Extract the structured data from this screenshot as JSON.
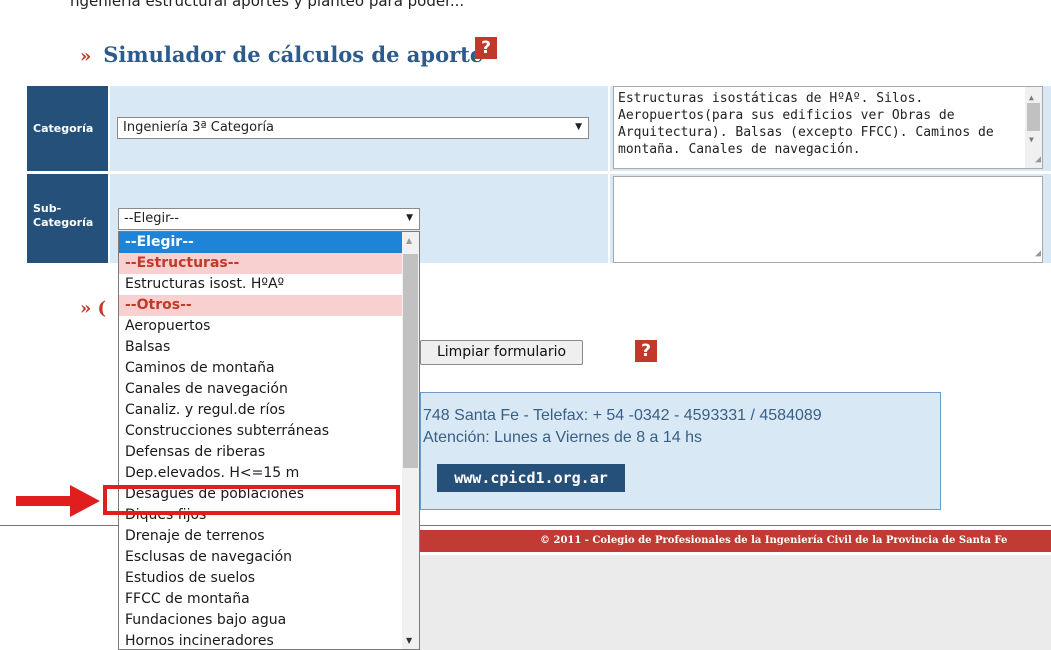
{
  "top_fragment": "ngeniería estructural aportes y planteo para poder...",
  "section_title": {
    "chevron": "»",
    "text": "Simulador de cálculos de aporte",
    "help": "?"
  },
  "row_categoria": {
    "label": "Categoría",
    "selected": "Ingeniería 3ª Categoría",
    "description": "Estructuras isostáticas de HºAº. Silos. Aeropuertos(para sus edificios ver Obras de Arquitectura). Balsas (excepto FFCC). Caminos de montaña. Canales de navegación."
  },
  "row_subcategoria": {
    "label_line1": "Sub-",
    "label_line2": "Categoría",
    "selected": "--Elegir--",
    "description": ""
  },
  "dropdown_items": [
    {
      "label": "--Elegir--",
      "kind": "selected"
    },
    {
      "label": "--Estructuras--",
      "kind": "group"
    },
    {
      "label": "Estructuras isost. HºAº",
      "kind": "option"
    },
    {
      "label": "--Otros--",
      "kind": "group"
    },
    {
      "label": "Aeropuertos",
      "kind": "option"
    },
    {
      "label": "Balsas",
      "kind": "option"
    },
    {
      "label": "Caminos de montaña",
      "kind": "option"
    },
    {
      "label": "Canales de navegación",
      "kind": "option"
    },
    {
      "label": "Canaliz. y regul.de ríos",
      "kind": "option"
    },
    {
      "label": "Construcciones subterráneas",
      "kind": "option"
    },
    {
      "label": "Defensas de riberas",
      "kind": "option"
    },
    {
      "label": "Dep.elevados. H<=15 m",
      "kind": "option"
    },
    {
      "label": "Desagües de poblaciones",
      "kind": "highlight"
    },
    {
      "label": "Diques fijos",
      "kind": "option"
    },
    {
      "label": "Drenaje de terrenos",
      "kind": "option"
    },
    {
      "label": "Esclusas de navegación",
      "kind": "option"
    },
    {
      "label": "Estudios de suelos",
      "kind": "option"
    },
    {
      "label": "FFCC de montaña",
      "kind": "option"
    },
    {
      "label": "Fundaciones bajo agua",
      "kind": "option"
    },
    {
      "label": "Hornos incineradores",
      "kind": "option"
    }
  ],
  "second_section_fragment": "»  (",
  "buttons": {
    "clear": "Limpiar formulario",
    "help": "?"
  },
  "contact": {
    "line1": "748 Santa Fe - Telefax: + 54 -0342 - 4593331 / 4584089",
    "line2": "Atención: Lunes a Viernes de 8 a 14 hs",
    "website": "www.cpicd1.org.ar"
  },
  "footer": "© 2011 - Colegio de Profesionales de la Ingeniería Civil de la Provincia de Santa Fe",
  "colors": {
    "label_bg": "#25507a",
    "cell_bg": "#d8e9f5",
    "accent_red": "#c0392b",
    "dropdown_selected": "#1e84d8",
    "group_bg": "#f8d0d0",
    "annotation_red": "#e01e1e"
  }
}
